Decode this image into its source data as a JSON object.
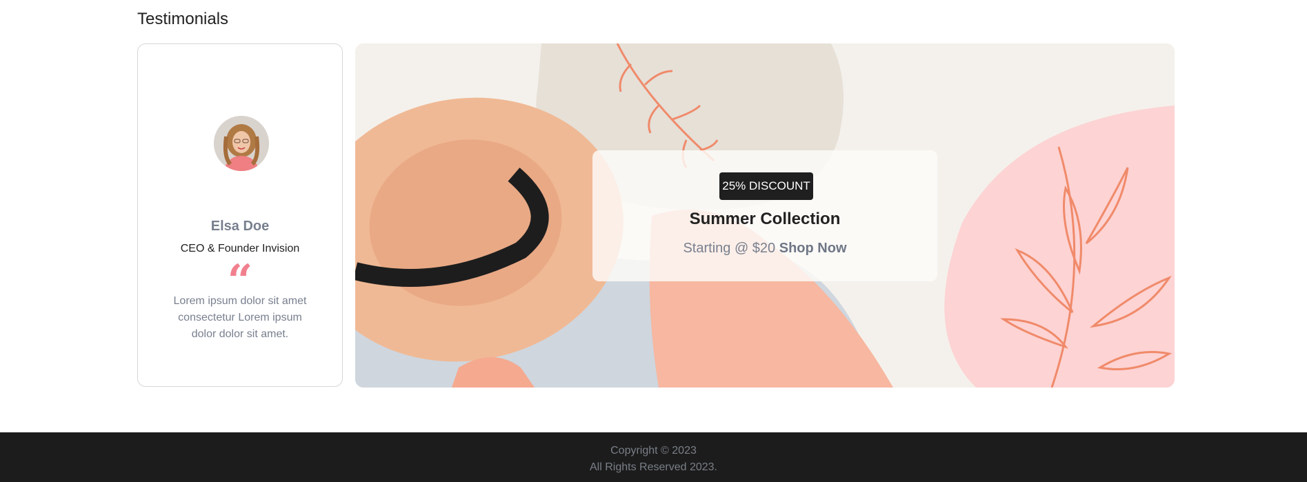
{
  "section": {
    "title": "Testimonials"
  },
  "testimonial": {
    "name": "Elsa Doe",
    "role": "CEO & Founder Invision",
    "quote_mark": "“",
    "text": "Lorem ipsum dolor sit amet consectetur Lorem ipsum dolor dolor sit amet."
  },
  "banner": {
    "badge": "25% DISCOUNT",
    "title": "Summer Collection",
    "starting_text": "Starting @ $20",
    "shop_label": "Shop Now"
  },
  "footer": {
    "copyright": "Copyright © 2023",
    "rights": "All Rights Reserved 2023."
  },
  "colors": {
    "accent_pink": "#f1808f",
    "muted_text": "#787f8e",
    "badge_bg": "#1f1f1f",
    "footer_bg": "#1c1c1c"
  }
}
